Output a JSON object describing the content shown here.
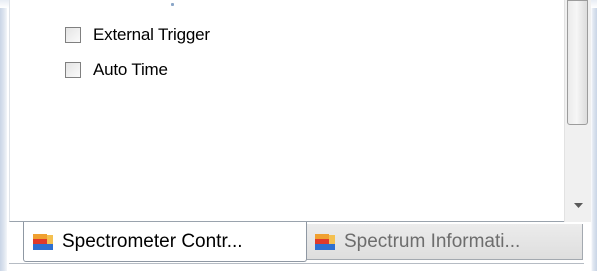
{
  "options": [
    {
      "label": "External Trigger",
      "checked": false
    },
    {
      "label": "Auto Time",
      "checked": false
    }
  ],
  "tabs": [
    {
      "label": "Spectrometer Contr...",
      "active": true,
      "icon": "panel-window-icon"
    },
    {
      "label": "Spectrum Informati...",
      "active": false,
      "icon": "panel-window-icon"
    }
  ],
  "colors": {
    "icon_orange": "#f0a030",
    "icon_blue": "#2f6fd0",
    "icon_red": "#e03a2a"
  }
}
